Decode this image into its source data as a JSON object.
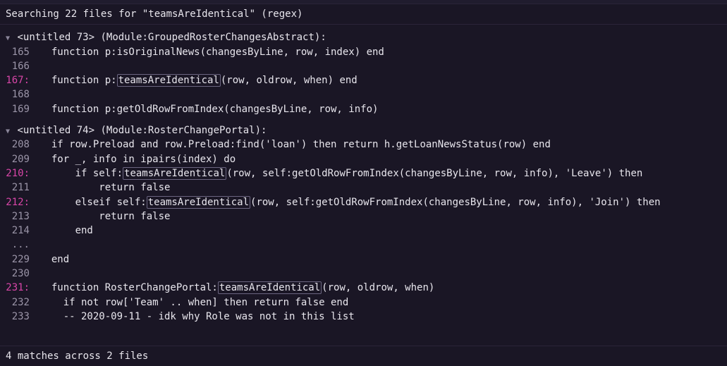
{
  "search": {
    "header": "Searching 22 files for \"teamsAreIdentical\" (regex)"
  },
  "files": [
    {
      "name": "<untitled 73> (Module:GroupedRosterChangesAbstract):",
      "lines": [
        {
          "num": "165",
          "match": false,
          "text": "  function p:isOriginalNews(changesByLine, row, index) end"
        },
        {
          "num": "166",
          "match": false,
          "text": ""
        },
        {
          "num": "167",
          "match": true,
          "prefix": "  function p:",
          "highlight": "teamsAreIdentical",
          "suffix": "(row, oldrow, when) end"
        },
        {
          "num": "168",
          "match": false,
          "text": ""
        },
        {
          "num": "169",
          "match": false,
          "text": "  function p:getOldRowFromIndex(changesByLine, row, info)"
        }
      ]
    },
    {
      "name": "<untitled 74> (Module:RosterChangePortal):",
      "lines": [
        {
          "num": "208",
          "match": false,
          "text": "  if row.Preload and row.Preload:find('loan') then return h.getLoanNewsStatus(row) end"
        },
        {
          "num": "209",
          "match": false,
          "text": "  for _, info in ipairs(index) do"
        },
        {
          "num": "210",
          "match": true,
          "prefix": "      if self:",
          "highlight": "teamsAreIdentical",
          "suffix": "(row, self:getOldRowFromIndex(changesByLine, row, info), 'Leave') then"
        },
        {
          "num": "211",
          "match": false,
          "text": "          return false"
        },
        {
          "num": "212",
          "match": true,
          "prefix": "      elseif self:",
          "highlight": "teamsAreIdentical",
          "suffix": "(row, self:getOldRowFromIndex(changesByLine, row, info), 'Join') then"
        },
        {
          "num": "213",
          "match": false,
          "text": "          return false"
        },
        {
          "num": "214",
          "match": false,
          "text": "      end"
        },
        {
          "num": "...",
          "match": false,
          "ellipsis": true
        },
        {
          "num": "229",
          "match": false,
          "text": "  end"
        },
        {
          "num": "230",
          "match": false,
          "text": ""
        },
        {
          "num": "231",
          "match": true,
          "prefix": "  function RosterChangePortal:",
          "highlight": "teamsAreIdentical",
          "suffix": "(row, oldrow, when)"
        },
        {
          "num": "232",
          "match": false,
          "text": "    if not row['Team' .. when] then return false end"
        },
        {
          "num": "233",
          "match": false,
          "text": "    -- 2020-09-11 - idk why Role was not in this list"
        }
      ]
    }
  ],
  "footer": {
    "text": "4 matches across 2 files"
  }
}
